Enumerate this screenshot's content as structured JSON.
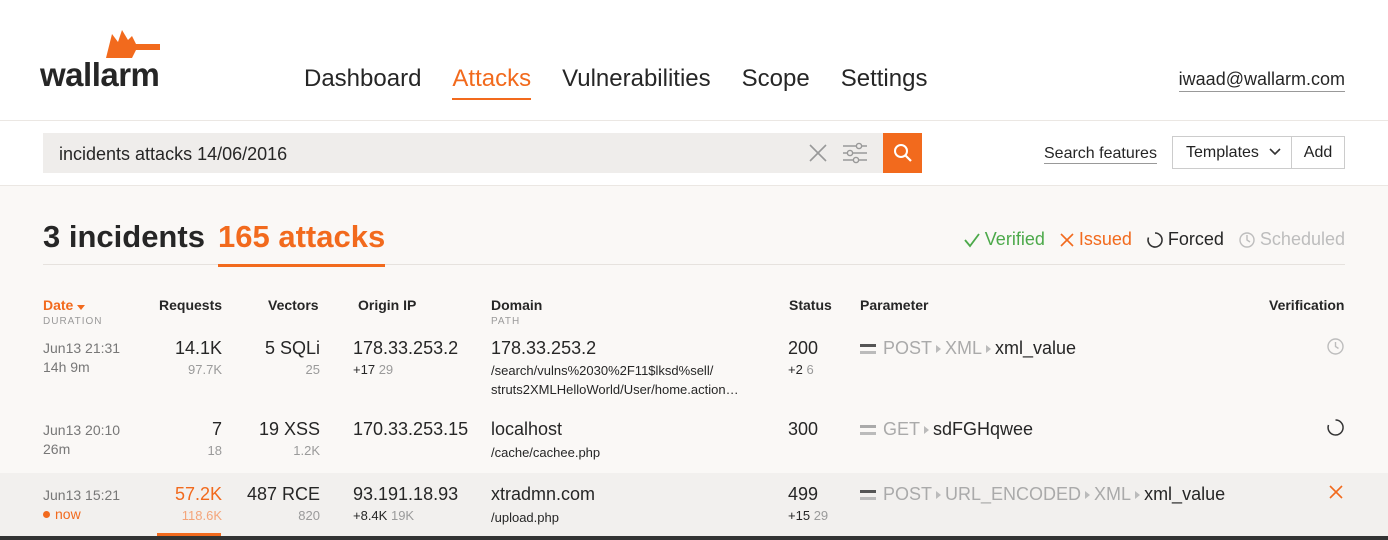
{
  "app": {
    "brand": "wallarm"
  },
  "nav": {
    "items": [
      {
        "label": "Dashboard",
        "active": false
      },
      {
        "label": "Attacks",
        "active": true
      },
      {
        "label": "Vulnerabilities",
        "active": false
      },
      {
        "label": "Scope",
        "active": false
      },
      {
        "label": "Settings",
        "active": false
      }
    ],
    "user_email": "iwaad@wallarm.com"
  },
  "search": {
    "query": "incidents attacks 14/06/2016",
    "features_link": "Search features",
    "templates_label": "Templates",
    "add_label": "Add"
  },
  "summary": {
    "incidents": "3 incidents",
    "attacks": "165 attacks"
  },
  "legend": {
    "verified": "Verified",
    "issued": "Issued",
    "forced": "Forced",
    "scheduled": "Scheduled"
  },
  "table": {
    "headers": {
      "date": "Date",
      "date_sub": "DURATION",
      "requests": "Requests",
      "vectors": "Vectors",
      "origin_ip": "Origin IP",
      "domain": "Domain",
      "domain_sub": "PATH",
      "status": "Status",
      "parameter": "Parameter",
      "verification": "Verification"
    },
    "rows": [
      {
        "date": "Jun13 21:31",
        "duration": "14h 9m",
        "requests": "14.1K",
        "requests_sub": "97.7K",
        "vectors": "5 SQLi",
        "vectors_sub": "25",
        "ip": "178.33.253.2",
        "ip_extra": "+17",
        "ip_extra_count": "29",
        "domain": "178.33.253.2",
        "path1": "/search/vulns%2030%2F11$lksd%sell/",
        "path2": "struts2XMLHelloWorld/User/home.action…",
        "status": "200",
        "status_extra": "+2",
        "status_extra_count": "6",
        "param_method": "POST",
        "param_parts": [
          "XML"
        ],
        "param_name": "xml_value",
        "verification": "scheduled"
      },
      {
        "date": "Jun13 20:10",
        "duration": "26m",
        "requests": "7",
        "requests_sub": "18",
        "vectors": "19 XSS",
        "vectors_sub": "1.2K",
        "ip": "170.33.253.15",
        "domain": "localhost",
        "path1": "/cache/cachee.php",
        "status": "300",
        "param_method": "GET",
        "param_parts": [],
        "param_name": "sdFGHqwee",
        "verification": "forced"
      },
      {
        "date": "Jun13 15:21",
        "duration": "now",
        "requests": "57.2K",
        "requests_sub": "118.6K",
        "vectors": "487 RCE",
        "vectors_sub": "820",
        "ip": "93.191.18.93",
        "ip_extra": "+8.4K",
        "ip_extra_count": "19K",
        "domain": "xtradmn.com",
        "path1": "/upload.php",
        "status": "499",
        "status_extra": "+15",
        "status_extra_count": "29",
        "param_method": "POST",
        "param_parts": [
          "URL_ENCODED",
          "XML"
        ],
        "param_name": "xml_value",
        "verification": "issued"
      }
    ]
  },
  "colors": {
    "accent": "#f26a1d",
    "verified": "#4ca94a",
    "muted": "#bdbdbd"
  }
}
